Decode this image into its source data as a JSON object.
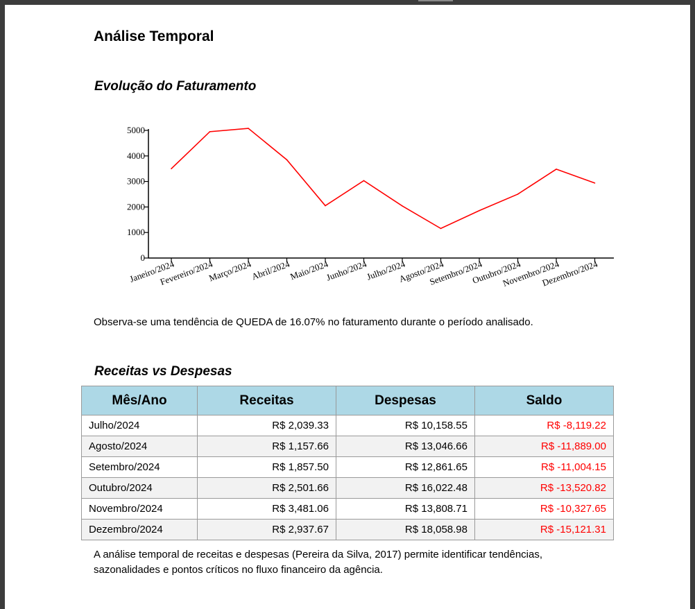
{
  "page": {
    "title": "Análise Temporal",
    "section1_title": "Evolução do Faturamento",
    "section1_note": "Observa-se uma tendência de QUEDA de 16.07% no faturamento durante o período analisado.",
    "section2_title": "Receitas vs Despesas",
    "section2_note_line1": "A análise temporal de receitas e despesas (Pereira da Silva, 2017) permite identificar tendências,",
    "section2_note_line2": "sazonalidades e pontos críticos no fluxo financeiro da agência."
  },
  "chart_data": {
    "type": "line",
    "title": "",
    "xlabel": "",
    "ylabel": "",
    "categories": [
      "Janeiro/2024",
      "Fevereiro/2024",
      "Março/2024",
      "Abril/2024",
      "Maio/2024",
      "Junho/2024",
      "Julho/2024",
      "Agosto/2024",
      "Setembro/2024",
      "Outubro/2024",
      "Novembro/2024",
      "Dezembro/2024"
    ],
    "values": [
      3500,
      4950,
      5080,
      3850,
      2050,
      3030,
      2039.33,
      1157.66,
      1857.5,
      2501.66,
      3481.06,
      2937.67
    ],
    "yticks": [
      "0",
      "1000",
      "2000",
      "3000",
      "4000",
      "5000"
    ],
    "ylim": [
      0,
      5000
    ],
    "grid": false,
    "line_color": "#ff0000"
  },
  "table": {
    "headers": [
      "Mês/Ano",
      "Receitas",
      "Despesas",
      "Saldo"
    ],
    "rows": [
      [
        "Julho/2024",
        "R$ 2,039.33",
        "R$ 10,158.55",
        "R$ -8,119.22"
      ],
      [
        "Agosto/2024",
        "R$ 1,157.66",
        "R$ 13,046.66",
        "R$ -11,889.00"
      ],
      [
        "Setembro/2024",
        "R$ 1,857.50",
        "R$ 12,861.65",
        "R$ -11,004.15"
      ],
      [
        "Outubro/2024",
        "R$ 2,501.66",
        "R$ 16,022.48",
        "R$ -13,520.82"
      ],
      [
        "Novembro/2024",
        "R$ 3,481.06",
        "R$ 13,808.71",
        "R$ -10,327.65"
      ],
      [
        "Dezembro/2024",
        "R$ 2,937.67",
        "R$ 18,058.98",
        "R$ -15,121.31"
      ]
    ],
    "header_color": "#add8e6",
    "negative_color": "#ff0000"
  }
}
